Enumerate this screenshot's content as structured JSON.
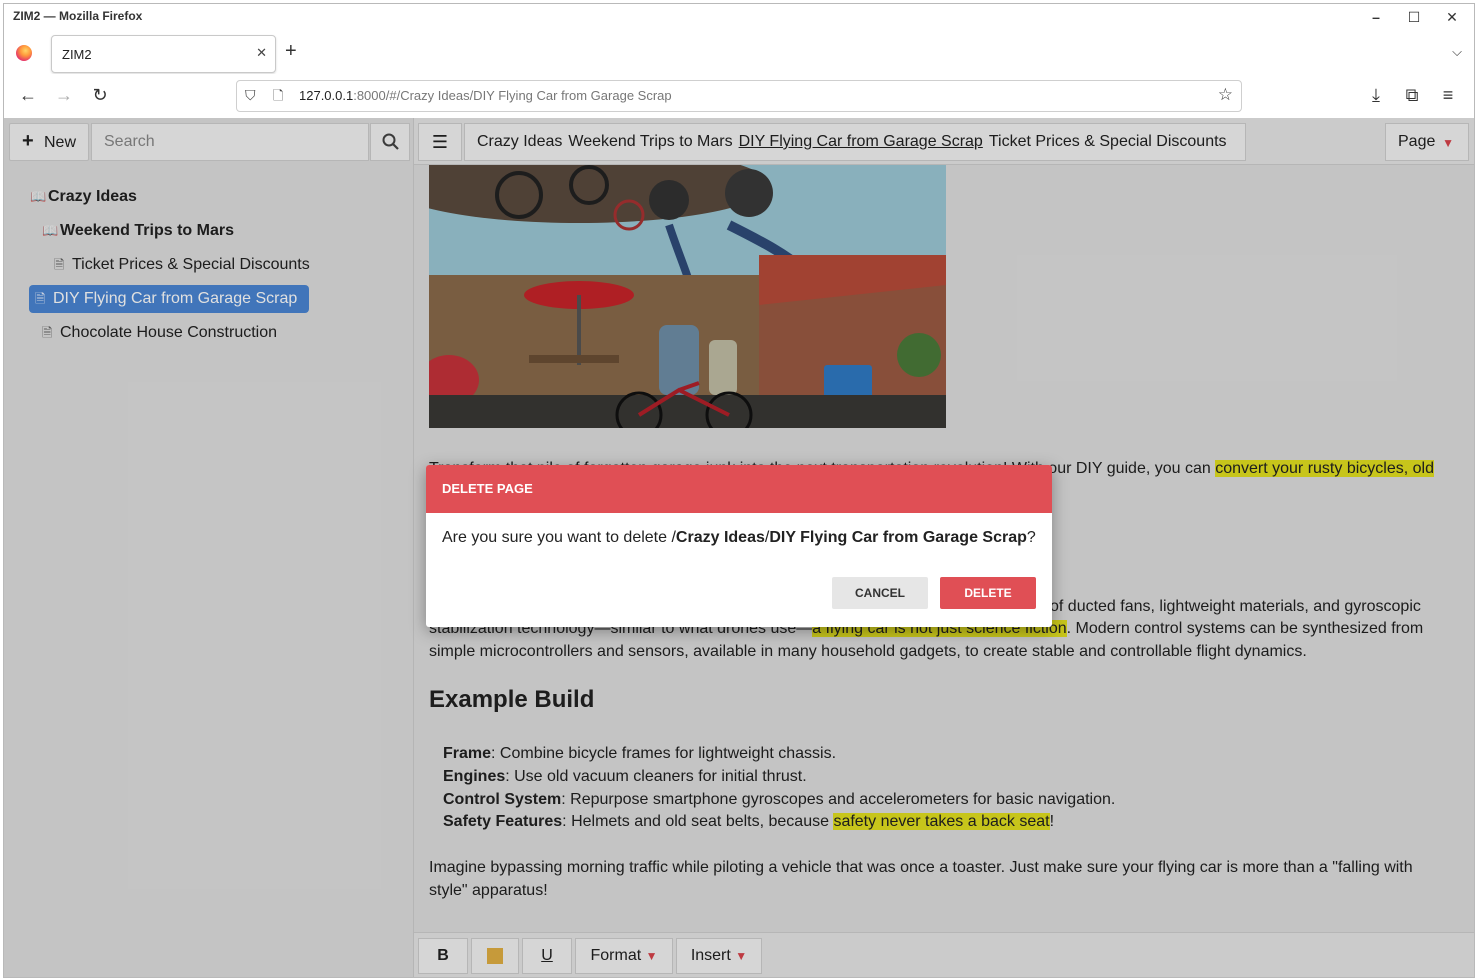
{
  "browser": {
    "window_title": "ZIM2 — Mozilla Firefox",
    "tab_title": "ZIM2",
    "url_host": "127.0.0.1",
    "url_rest": ":8000/#/Crazy Ideas/DIY Flying Car from Garage Scrap"
  },
  "sidebar": {
    "new_label": "New",
    "search_placeholder": "Search",
    "tree": [
      {
        "label": "Crazy Ideas",
        "bold": true
      },
      {
        "label": "Weekend Trips to Mars",
        "bold": true
      },
      {
        "label": "Ticket Prices & Special Discounts"
      },
      {
        "label": "DIY Flying Car from Garage Scrap",
        "selected": true
      },
      {
        "label": "Chocolate House Construction"
      }
    ]
  },
  "breadcrumbs": [
    "Crazy Ideas",
    "Weekend Trips to Mars",
    "DIY Flying Car from Garage Scrap",
    "Ticket Prices & Special Discounts"
  ],
  "page_menu_label": "Page",
  "article": {
    "intro_start": "Transform that pile of forgotten garage junk into the next transportation revolution! With our DIY guide, you can ",
    "intro_hl": "convert your rusty bicycles, old",
    "para2_a": "of ducted fans, lightweight materials, and gyroscopic",
    "para2_b_pre": "stabilization technology—similar to what drones use—",
    "para2_b_hl": "a flying car is not just science fiction",
    "para2_b_post": ". Modern control systems can be synthesized from",
    "para2_c": "simple microcontrollers and sensors, available in many household gadgets, to create stable and controllable flight dynamics.",
    "heading": "Example Build",
    "list": [
      {
        "term": "Frame",
        "text": ": Combine bicycle frames for lightweight chassis."
      },
      {
        "term": "Engines",
        "text": ": Use old vacuum cleaners for initial thrust."
      },
      {
        "term": "Control System",
        "text": ": Repurpose smartphone gyroscopes and accelerometers for basic navigation."
      },
      {
        "term": "Safety Features",
        "text": ": Helmets and old seat belts, because ",
        "hl": "safety never takes a back seat",
        "end": "!"
      }
    ],
    "closing_a": "Imagine bypassing morning traffic while piloting a vehicle that was once a toaster. Just make sure your flying car is more than a \"falling with",
    "closing_b": "style\" apparatus!"
  },
  "toolbar": {
    "bold": "B",
    "underline": "U",
    "format": "Format",
    "insert": "Insert"
  },
  "dialog": {
    "title": "DELETE PAGE",
    "msg_pre": "Are you sure you want to delete /",
    "msg_path1": "Crazy Ideas",
    "msg_sep": "/",
    "msg_path2": "DIY Flying Car from Garage Scrap",
    "msg_post": "?",
    "cancel": "CANCEL",
    "delete": "DELETE"
  },
  "colors": {
    "accent_red": "#e04f55",
    "selection_blue": "#4a86d4",
    "highlight_yellow": "#e3e11f"
  }
}
